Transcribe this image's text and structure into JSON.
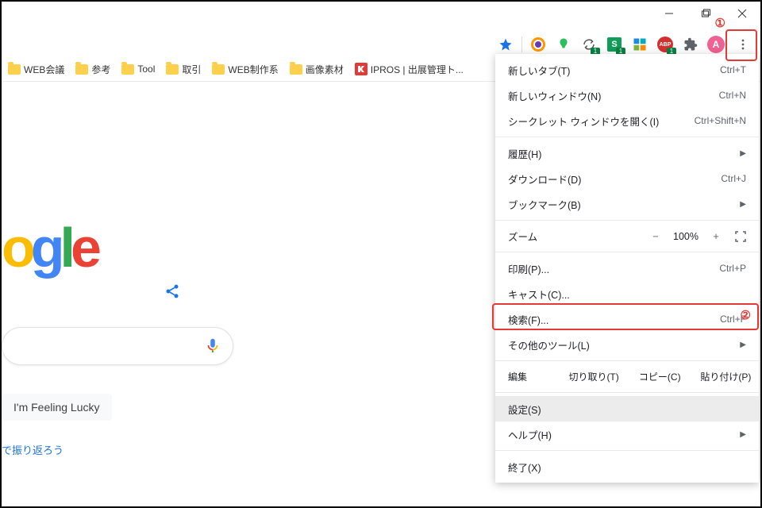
{
  "window_controls": {
    "minimize": "minimize",
    "maximize": "maximize",
    "close": "close"
  },
  "toolbar": {
    "star": "bookmark-star",
    "extensions": [
      {
        "name": "ext-circle",
        "color": "#ff9800",
        "inner": "#673ab7",
        "badge": null
      },
      {
        "name": "ext-evernote",
        "color": "#2dbe60",
        "badge": null
      },
      {
        "name": "ext-recycle",
        "color": "#555",
        "badge": "1"
      },
      {
        "name": "ext-s",
        "color": "#0f9d58",
        "letter": "S",
        "badge": "1"
      },
      {
        "name": "ext-flag",
        "color": "#1e88e5",
        "badge": null
      },
      {
        "name": "ext-abp",
        "color": "#d32f2f",
        "letter": "ABP",
        "badge": "1"
      }
    ],
    "puzzle": "extensions-puzzle",
    "avatar_letter": "A",
    "menu": "menu"
  },
  "bookmarks": [
    {
      "type": "folder",
      "label": "WEB会議"
    },
    {
      "type": "folder",
      "label": "参考"
    },
    {
      "type": "folder",
      "label": "Tool"
    },
    {
      "type": "folder",
      "label": "取引"
    },
    {
      "type": "folder",
      "label": "WEB制作系"
    },
    {
      "type": "folder",
      "label": "画像素材"
    },
    {
      "type": "ipros",
      "label": "IPROS | 出展管理ト..."
    }
  ],
  "page": {
    "logo_letters": [
      "o",
      "g",
      "l",
      "e"
    ],
    "lucky": "I'm Feeling Lucky",
    "promo": "で振り返ろう"
  },
  "menu": {
    "new_tab": {
      "label": "新しいタブ(T)",
      "shortcut": "Ctrl+T"
    },
    "new_window": {
      "label": "新しいウィンドウ(N)",
      "shortcut": "Ctrl+N"
    },
    "incognito": {
      "label": "シークレット ウィンドウを開く(I)",
      "shortcut": "Ctrl+Shift+N"
    },
    "history": {
      "label": "履歴(H)",
      "arrow": true
    },
    "downloads": {
      "label": "ダウンロード(D)",
      "shortcut": "Ctrl+J"
    },
    "bookmarks": {
      "label": "ブックマーク(B)",
      "arrow": true
    },
    "zoom": {
      "label": "ズーム",
      "minus": "−",
      "value": "100%",
      "plus": "+"
    },
    "print": {
      "label": "印刷(P)...",
      "shortcut": "Ctrl+P"
    },
    "cast": {
      "label": "キャスト(C)..."
    },
    "find": {
      "label": "検索(F)...",
      "shortcut": "Ctrl+F"
    },
    "more_tools": {
      "label": "その他のツール(L)",
      "arrow": true
    },
    "edit": {
      "label": "編集",
      "cut": "切り取り(T)",
      "copy": "コピー(C)",
      "paste": "貼り付け(P)"
    },
    "settings": {
      "label": "設定(S)"
    },
    "help": {
      "label": "ヘルプ(H)",
      "arrow": true
    },
    "exit": {
      "label": "終了(X)"
    }
  },
  "callouts": {
    "one": "①",
    "two": "②"
  }
}
